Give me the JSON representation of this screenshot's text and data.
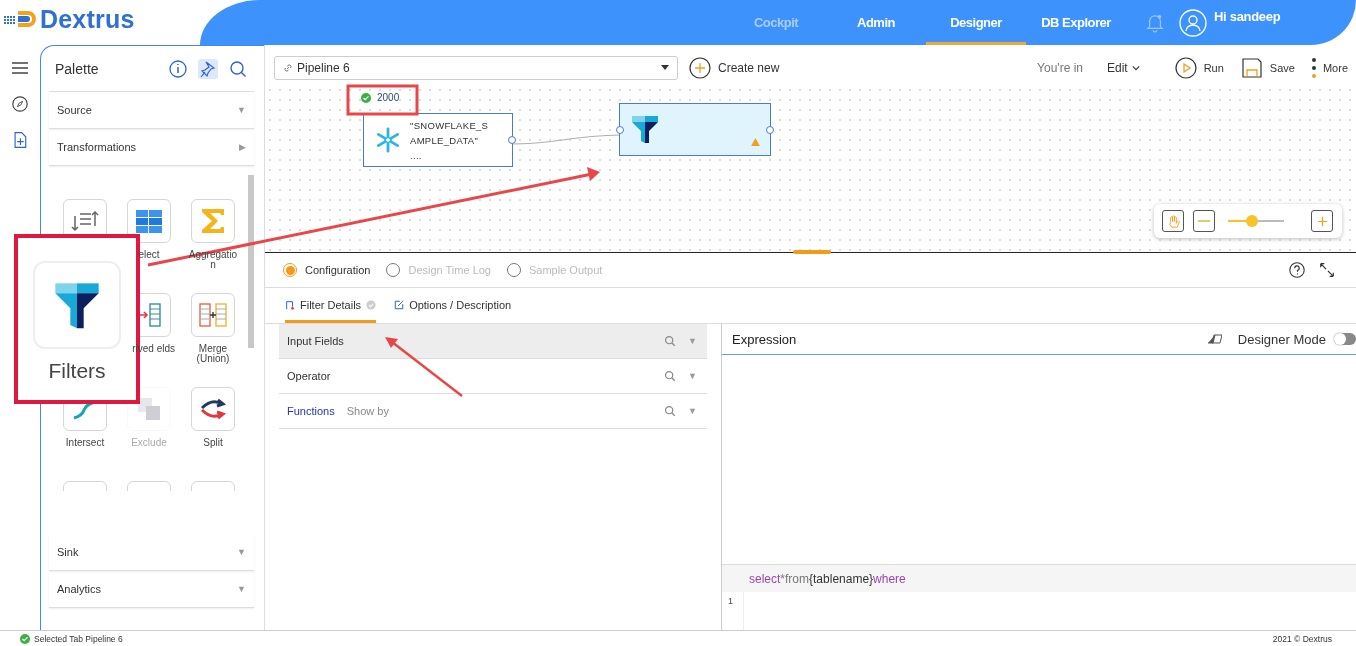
{
  "header": {
    "logo": "Dextrus",
    "nav": [
      {
        "label": "Cockpit",
        "selected": false,
        "disabled": true
      },
      {
        "label": "Admin",
        "selected": false,
        "disabled": false
      },
      {
        "label": "Designer",
        "selected": true,
        "disabled": false
      },
      {
        "label": "DB Explorer",
        "selected": false,
        "disabled": false
      }
    ],
    "greeting": "Hi sandeep"
  },
  "rail": [
    {
      "kind": "menu",
      "selected": false
    },
    {
      "kind": "compass",
      "selected": false
    },
    {
      "kind": "add",
      "selected": true
    }
  ],
  "palette": {
    "title": "Palette",
    "pinned": true,
    "top_sections": [
      {
        "label": "Source",
        "caret": "▼"
      },
      {
        "label": "Transformations",
        "caret": "▶"
      }
    ],
    "tiles": [
      {
        "kind": "sort",
        "disabled": false
      },
      {
        "kind": "select",
        "label": "elect",
        "disabled": false
      },
      {
        "kind": "sum",
        "label": "Aggregation",
        "disabled": false
      },
      {
        "kind": "derived",
        "label": "rived elds",
        "disabled": false
      },
      {
        "kind": "merge",
        "label": "Merge (Union)",
        "disabled": false
      },
      {
        "kind": "intersect",
        "label": "Intersect",
        "disabled": false
      },
      {
        "kind": "exclude",
        "label": "Exclude",
        "disabled": true
      },
      {
        "kind": "split",
        "label": "Split",
        "disabled": false
      },
      {
        "kind": "blank",
        "disabled": false
      },
      {
        "kind": "blank",
        "disabled": false
      },
      {
        "kind": "blank",
        "disabled": false
      }
    ],
    "bottom_sections": [
      {
        "label": "Sink",
        "caret": "▼"
      },
      {
        "label": "Analytics",
        "caret": "▼"
      }
    ]
  },
  "toolbar": {
    "pipeline": "Pipeline 6",
    "create": "Create new",
    "mode_label": "You're in",
    "mode": "Edit",
    "actions": [
      {
        "kind": "run",
        "label": "Run"
      },
      {
        "kind": "save",
        "label": "Save"
      },
      {
        "kind": "more",
        "label": "More"
      }
    ]
  },
  "canvas": {
    "badge": "2000",
    "source_node": "\"SNOWFLAKE_SAMPLE_DATA\" ....",
    "filter_node": {
      "selected": true,
      "warning": true
    },
    "zoom": {
      "level": 0.43
    }
  },
  "panel": {
    "tabs": [
      {
        "label": "Configuration",
        "selected": true,
        "disabled": false
      },
      {
        "label": "Design Time Log",
        "selected": false,
        "disabled": true
      },
      {
        "label": "Sample Output",
        "selected": false,
        "disabled": true
      }
    ],
    "subtabs": [
      {
        "label": "Filter Details",
        "selected": true,
        "kind": "details"
      },
      {
        "label": "Options / Description",
        "selected": false,
        "kind": "options"
      }
    ],
    "fields": [
      {
        "label": "Input Fields",
        "selected": true,
        "kind": "field",
        "caret": "▼"
      },
      {
        "label": "Operator",
        "selected": false,
        "kind": "field",
        "caret": "▼"
      },
      {
        "label": "Functions",
        "hint": "Show by",
        "selected": false,
        "kind": "functions",
        "caret": "▼"
      }
    ],
    "expression": {
      "title": "Expression",
      "designer_mode": {
        "label": "Designer Mode",
        "on": false
      },
      "hint": [
        {
          "text": "select",
          "kind": "keyword"
        },
        {
          "text": "*",
          "kind": "plain"
        },
        {
          "text": " from",
          "kind": "plain"
        },
        {
          "text": "{tablename}",
          "kind": "name"
        },
        {
          "text": "where",
          "kind": "keyword"
        }
      ],
      "line_numbers": [
        "1"
      ]
    }
  },
  "callout": {
    "label": "Filters"
  },
  "status": {
    "text": "Selected Tab Pipeline 6",
    "copyright": "2021 © Dextrus"
  }
}
